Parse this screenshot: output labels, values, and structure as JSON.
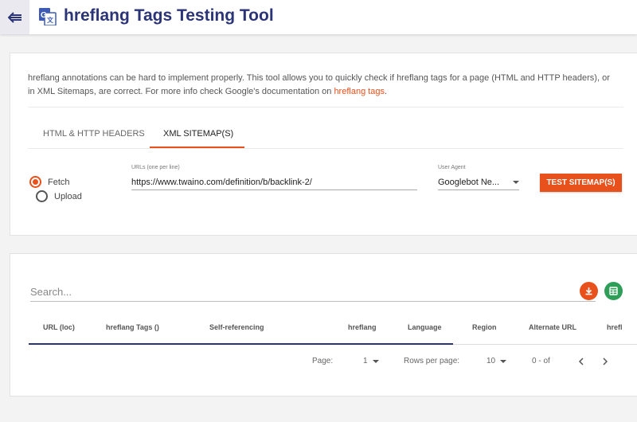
{
  "header": {
    "title": "hreflang Tags Testing Tool",
    "back_icon": "arrow-left-icon",
    "logo_icon": "google-translate-icon"
  },
  "intro": {
    "text": "hreflang annotations can be hard to implement properly. This tool allows you to quickly check if hreflang tags for a page (HTML and HTTP headers), or in XML Sitemaps, are correct. For more info check Google's documentation on ",
    "link": "hreflang tags",
    "suffix": "."
  },
  "tabs": [
    {
      "label": "HTML & HTTP HEADERS",
      "active": false
    },
    {
      "label": "XML SITEMAP(S)",
      "active": true
    }
  ],
  "form": {
    "mode_options": [
      {
        "label": "Fetch",
        "selected": true
      },
      {
        "label": "Upload",
        "selected": false
      }
    ],
    "urls_label": "URLs (one per line)",
    "urls_value": "https://www.twaino.com/definition/b/backlink-2/",
    "user_agent_label": "User Agent",
    "user_agent_value": "Googlebot Ne...",
    "submit_label": "TEST SITEMAP(S)"
  },
  "results": {
    "search_placeholder": "Search...",
    "download_icon": "download-icon",
    "sheet_icon": "spreadsheet-icon",
    "columns": [
      "URL (loc)",
      "hreflang Tags ()",
      "Self-referencing",
      "hreflang",
      "Language",
      "Region",
      "Alternate URL",
      "hrefl"
    ],
    "pagination": {
      "page_label": "Page:",
      "page_value": "1",
      "rows_label": "Rows per page:",
      "rows_value": "10",
      "range": "0 - of"
    }
  },
  "colors": {
    "accent": "#e8501c",
    "title": "#2c3478",
    "sheet_green": "#2f9e58"
  }
}
